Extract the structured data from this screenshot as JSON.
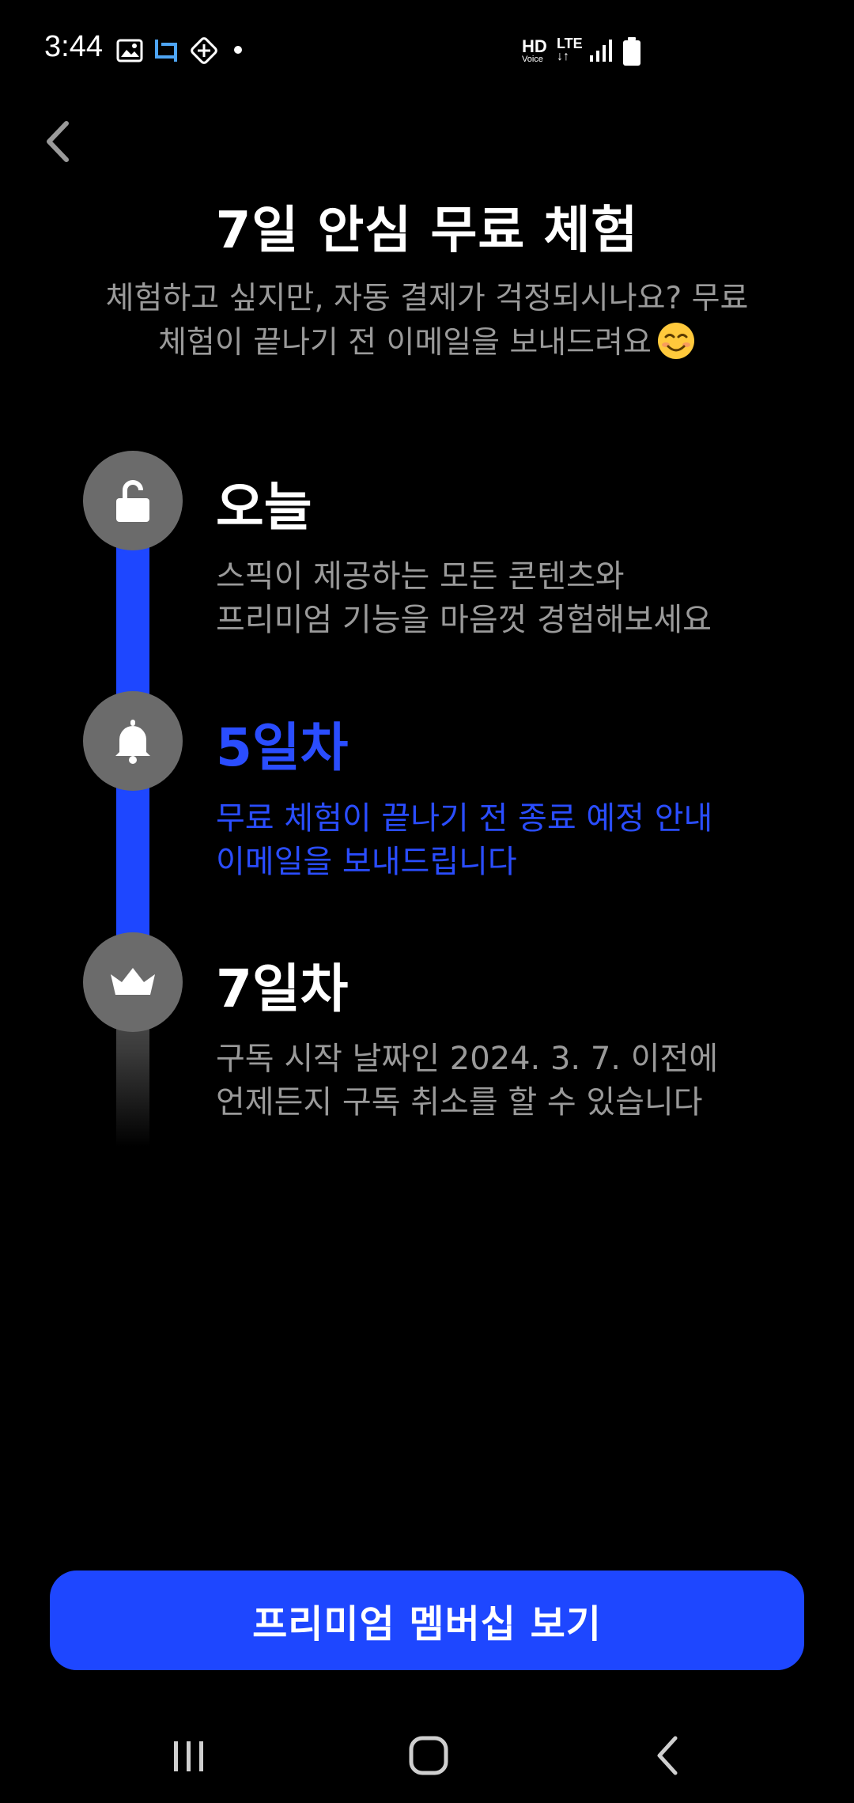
{
  "status_bar": {
    "time": "3:44",
    "hd": "HD",
    "voice": "Voice",
    "lte": "LTE",
    "lte_arrows": "↓↑",
    "icons": [
      "gallery-icon",
      "screenshot-icon",
      "app-icon",
      "notification-dot",
      "signal-icon",
      "battery-icon"
    ]
  },
  "header": {
    "back_icon": "chevron-left-icon",
    "title": "7일 안심 무료 체험",
    "subtitle_line1": "체험하고 싶지만, 자동 결제가 걱정되시나요? 무료",
    "subtitle_line2": "체험이 끝나기 전 이메일을 보내드려요",
    "subtitle_emoji": "smiling-face-emoji"
  },
  "timeline": {
    "steps": [
      {
        "icon": "unlock-icon",
        "title": "오늘",
        "desc_line1": "스픽이 제공하는 모든 콘텐츠와",
        "desc_line2": "프리미엄 기능을 마음껏 경험해보세요",
        "highlight": false
      },
      {
        "icon": "bell-icon",
        "title": "5일차",
        "desc_line1": "무료 체험이 끝나기 전 종료 예정 안내",
        "desc_line2": "이메일을 보내드립니다",
        "highlight": true
      },
      {
        "icon": "crown-icon",
        "title": "7일차",
        "desc_line1": "구독 시작 날짜인 2024. 3. 7. 이전에",
        "desc_line2": "언제든지 구독 취소를 할 수 있습니다",
        "highlight": false
      }
    ],
    "accent_color": "#1e47ff"
  },
  "cta": {
    "label": "프리미엄 멤버십 보기",
    "color": "#1e47ff"
  },
  "nav_bar": {
    "icons": [
      "recents-icon",
      "home-icon",
      "back-icon"
    ]
  }
}
